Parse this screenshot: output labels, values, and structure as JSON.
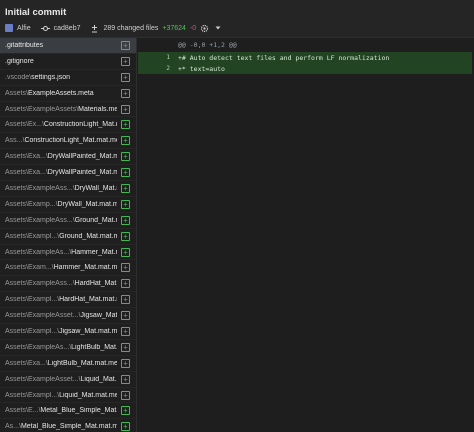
{
  "header": {
    "title": "Initial commit",
    "author": "Alfie",
    "sha": "cad8eb7",
    "changed_files": "289 changed files",
    "additions": "+37624",
    "deletions": "-0"
  },
  "files": [
    {
      "prefix": "",
      "name": ".gitattributes"
    },
    {
      "prefix": "",
      "name": ".gitignore"
    },
    {
      "prefix": ".vscode\\",
      "name": "settings.json"
    },
    {
      "prefix": "Assets\\",
      "name": "ExampleAssets.meta"
    },
    {
      "prefix": "Assets\\ExampleAssets\\",
      "name": "Materials.meta"
    },
    {
      "prefix": "Assets\\Ex...\\",
      "name": "ConstructionLight_Mat.mat"
    },
    {
      "prefix": "Ass...\\",
      "name": "ConstructionLight_Mat.mat.meta"
    },
    {
      "prefix": "Assets\\Exa...\\",
      "name": "DryWallPainted_Mat.mat"
    },
    {
      "prefix": "Assets\\Exa...\\",
      "name": "DryWallPainted_Mat.mat.meta"
    },
    {
      "prefix": "Assets\\ExampleAss...\\",
      "name": "DryWall_Mat.mat"
    },
    {
      "prefix": "Assets\\Examp...\\",
      "name": "DryWall_Mat.mat.meta"
    },
    {
      "prefix": "Assets\\ExampleAss...\\",
      "name": "Ground_Mat.mat"
    },
    {
      "prefix": "Assets\\Exampl...\\",
      "name": "Ground_Mat.mat.meta"
    },
    {
      "prefix": "Assets\\ExampleAs...\\",
      "name": "Hammer_Mat.mat"
    },
    {
      "prefix": "Assets\\Exam...\\",
      "name": "Hammer_Mat.mat.meta"
    },
    {
      "prefix": "Assets\\ExampleAss...\\",
      "name": "HardHat_Mat.mat"
    },
    {
      "prefix": "Assets\\Exampl...\\",
      "name": "HardHat_Mat.mat.meta"
    },
    {
      "prefix": "Assets\\ExampleAsset...\\",
      "name": "Jigsaw_Mat.mat"
    },
    {
      "prefix": "Assets\\Exampl...\\",
      "name": "Jigsaw_Mat.mat.meta"
    },
    {
      "prefix": "Assets\\ExampleAs...\\",
      "name": "LightBulb_Mat.mat"
    },
    {
      "prefix": "Assets\\Exa...\\",
      "name": "LightBulb_Mat.mat.meta"
    },
    {
      "prefix": "Assets\\ExampleAsset...\\",
      "name": "Liquid_Mat.mat"
    },
    {
      "prefix": "Assets\\Exampl...\\",
      "name": "Liquid_Mat.mat.meta"
    },
    {
      "prefix": "Assets\\E...\\",
      "name": "Metal_Blue_Simple_Mat.mat"
    },
    {
      "prefix": "As...\\",
      "name": "Metal_Blue_Simple_Mat.mat.meta"
    }
  ],
  "diff": {
    "hunk_header": "@@ -0,0 +1,2 @@",
    "lines": [
      {
        "num": "1",
        "text": "+# Auto detect text files and perform LF normalization"
      },
      {
        "num": "2",
        "text": "+* text=auto"
      }
    ]
  },
  "colors": {
    "addition": "#4ec94e",
    "deletion": "#e05252",
    "added_line_bg": "#224422",
    "selected_row": "#3a3d41"
  },
  "icons": {
    "author": "avatar",
    "sha": "commit-icon",
    "files": "file-diff-icon",
    "settings": "gear-icon",
    "file_status": "file-added-icon"
  }
}
